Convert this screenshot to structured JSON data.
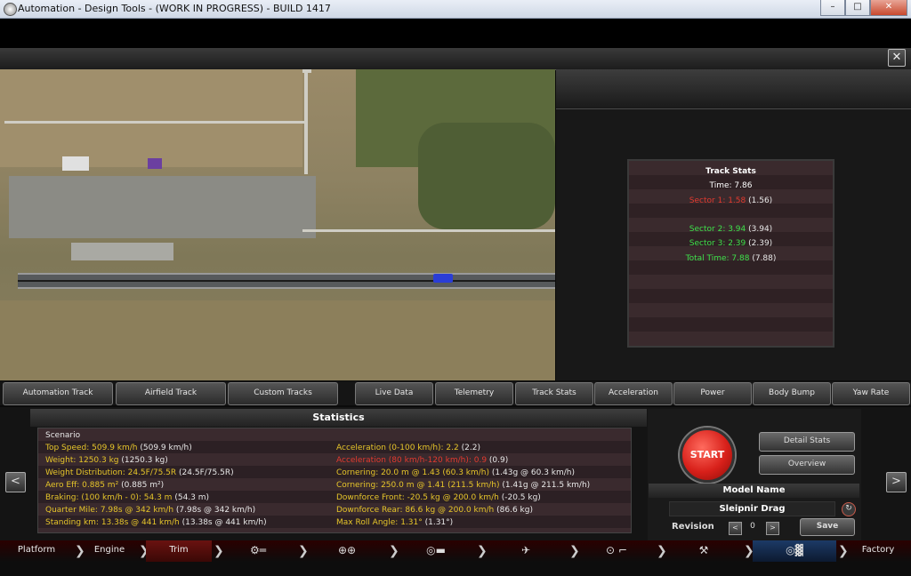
{
  "window": {
    "title": "Automation - Design Tools - (WORK IN PROGRESS) - BUILD 1417",
    "minimize": "–",
    "maximize": "□",
    "close": "✕"
  },
  "panel_close": "✕",
  "track_stats": {
    "title": "Track Stats",
    "time": "Time: 7.86",
    "sector1": "Sector 1: 1.58",
    "sector1_prev": "(1.56)",
    "sector2": "Sector 2: 3.94",
    "sector2_prev": "(3.94)",
    "sector3": "Sector 3: 2.39",
    "sector3_prev": "(2.39)",
    "total": "Total Time: 7.88",
    "total_prev": "(7.88)"
  },
  "tabs": [
    {
      "label": "Automation Track"
    },
    {
      "label": "Airfield Track"
    },
    {
      "label": "Custom Tracks"
    },
    {
      "label": "Live Data"
    },
    {
      "label": "Telemetry"
    },
    {
      "label": "Track Stats"
    },
    {
      "label": "Acceleration"
    },
    {
      "label": "Power"
    },
    {
      "label": "Body Bump"
    },
    {
      "label": "Yaw Rate"
    }
  ],
  "statistics": {
    "title": "Statistics",
    "scenario": "Scenario",
    "left": [
      {
        "label": "Top Speed: 509.9 km/h",
        "prev": "(509.9 km/h)"
      },
      {
        "label": "Weight: 1250.3 kg",
        "prev": "(1250.3 kg)"
      },
      {
        "label": "Weight Distribution: 24.5F/75.5R",
        "prev": "(24.5F/75.5R)"
      },
      {
        "label": "Aero Eff: 0.885 m²",
        "prev": "(0.885 m²)"
      },
      {
        "label": "Braking: (100 km/h - 0): 54.3 m",
        "prev": "(54.3 m)"
      },
      {
        "label": "Quarter Mile: 7.98s @ 342 km/h",
        "prev": "(7.98s @ 342 km/h)"
      },
      {
        "label": "Standing km: 13.38s @ 441 km/h",
        "prev": "(13.38s @ 441 km/h)"
      }
    ],
    "right": [
      {
        "label": "Acceleration (0-100 km/h): 2.2",
        "prev": "(2.2)",
        "color": "yellow"
      },
      {
        "label": "Acceleration (80 km/h-120 km/h): 0.9",
        "prev": "(0.9)",
        "color": "red"
      },
      {
        "label": "Cornering: 20.0 m @ 1.43 (60.3 km/h)",
        "prev": "(1.43g @ 60.3 km/h)",
        "color": "yellow"
      },
      {
        "label": "Cornering: 250.0 m @ 1.41 (211.5 km/h)",
        "prev": "(1.41g @ 211.5 km/h)",
        "color": "yellow"
      },
      {
        "label": "Downforce Front: -20.5 kg @ 200.0 km/h",
        "prev": "(-20.5 kg)",
        "color": "yellow"
      },
      {
        "label": "Downforce Rear: 86.6 kg @ 200.0 km/h",
        "prev": "(86.6 kg)",
        "color": "yellow"
      },
      {
        "label": "Max Roll Angle: 1.31°",
        "prev": "(1.31°)",
        "color": "yellow"
      }
    ]
  },
  "controls": {
    "start": "START",
    "detail_stats": "Detail Stats",
    "overview": "Overview",
    "model_name_label": "Model Name",
    "model_name_value": "Sleipnir Drag",
    "revision_label": "Revision",
    "revision_value": "0",
    "revision_prev": "<",
    "revision_next": ">",
    "save": "Save",
    "prev_arrow": "<",
    "next_arrow": ">",
    "refresh": "↻"
  },
  "nav": [
    {
      "label": "Platform"
    },
    {
      "label": "Engine"
    },
    {
      "label": "Trim"
    },
    {
      "label": "Factory"
    }
  ],
  "nav_icons": {
    "drivetrain": "⚙═",
    "wheels": "⊕⊕",
    "brakes": "◎▬",
    "aero": "✈",
    "steering": "⊙ ⌐",
    "tools": "⚒",
    "test": "◎▓"
  },
  "nav_sep": "❯",
  "colors": {
    "green": "#3ee04a",
    "red": "#e23a2f",
    "yellow": "#e6c52a",
    "start_red": "#d8201a"
  }
}
